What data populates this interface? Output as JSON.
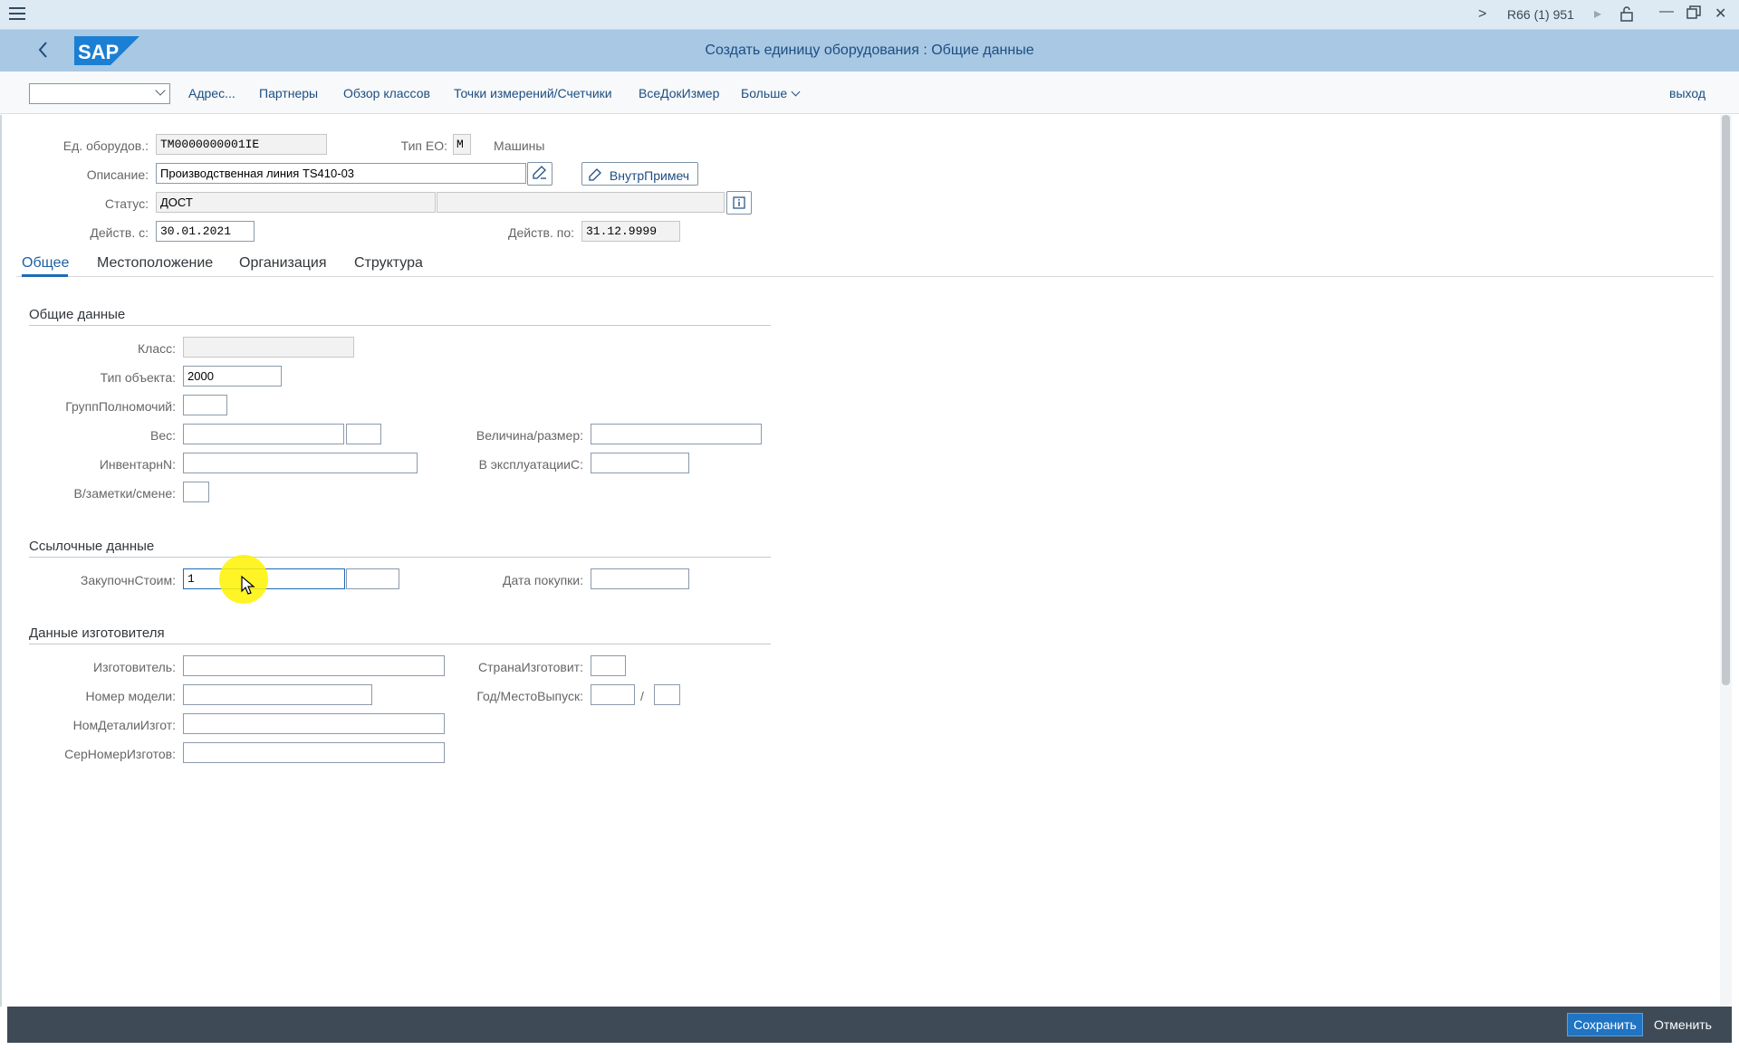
{
  "system": {
    "next_icon": ">",
    "session": "R66 (1) 951",
    "play_icon": "▸",
    "lock_icon": "lock",
    "minimize_icon": "—",
    "maximize_icon": "□",
    "close_icon": "✕"
  },
  "shell": {
    "logo": "SAP",
    "back_icon": "<",
    "title": "Создать единицу оборудования : Общие данные"
  },
  "toolbar": {
    "select_value": "",
    "items": [
      "Адрес...",
      "Партнеры",
      "Обзор классов",
      "Точки измерений/Счетчики",
      "ВсеДокИзмер"
    ],
    "more": "Больше",
    "exit": "выход"
  },
  "header": {
    "equipment_label": "Ед. оборудов.:",
    "equipment_value": "TM0000000001IE",
    "eo_type_label": "Тип ЕО:",
    "eo_type_value": "M",
    "eo_type_text": "Машины",
    "description_label": "Описание:",
    "description_value": "Производственная линия TS410-03",
    "note_button": "ВнутрПримеч",
    "status_label": "Статус:",
    "status_value": "ДОСТ",
    "status_value2": "",
    "valid_from_label": "Действ. с:",
    "valid_from_value": "30.01.2021",
    "valid_to_label": "Действ. по:",
    "valid_to_value": "31.12.9999"
  },
  "tabs": [
    "Общее",
    "Местоположение",
    "Организация",
    "Структура"
  ],
  "general": {
    "section": "Общие данные",
    "class_label": "Класс:",
    "class_value": "",
    "object_type_label": "Тип объекта:",
    "object_type_value": "2000",
    "auth_group_label": "ГруппПолномочий:",
    "weight_label": "Вес:",
    "size_label": "Величина/размер:",
    "inventory_label": "ИнвентарнN:",
    "startup_label": "В эксплуатацииС:",
    "shift_note_label": "В/заметки/смене:"
  },
  "reference": {
    "section": "Ссылочные данные",
    "acq_value_label": "ЗакупочнСтоим:",
    "acq_value": "1",
    "acq_date_label": "Дата покупки:"
  },
  "manufacturer": {
    "section": "Данные изготовителя",
    "manufacturer_label": "Изготовитель:",
    "country_label": "СтранаИзготовит:",
    "model_label": "Номер модели:",
    "year_label": "Год/МестоВыпуск:",
    "year_separator": "/",
    "part_label": "НомДеталиИзгот:",
    "serial_label": "СерНомерИзготов:"
  },
  "footer": {
    "save": "Сохранить",
    "cancel": "Отменить"
  },
  "colors": {
    "shell": "#a8c8e4",
    "accent": "#1f74c4",
    "footer": "#3e4a56"
  }
}
